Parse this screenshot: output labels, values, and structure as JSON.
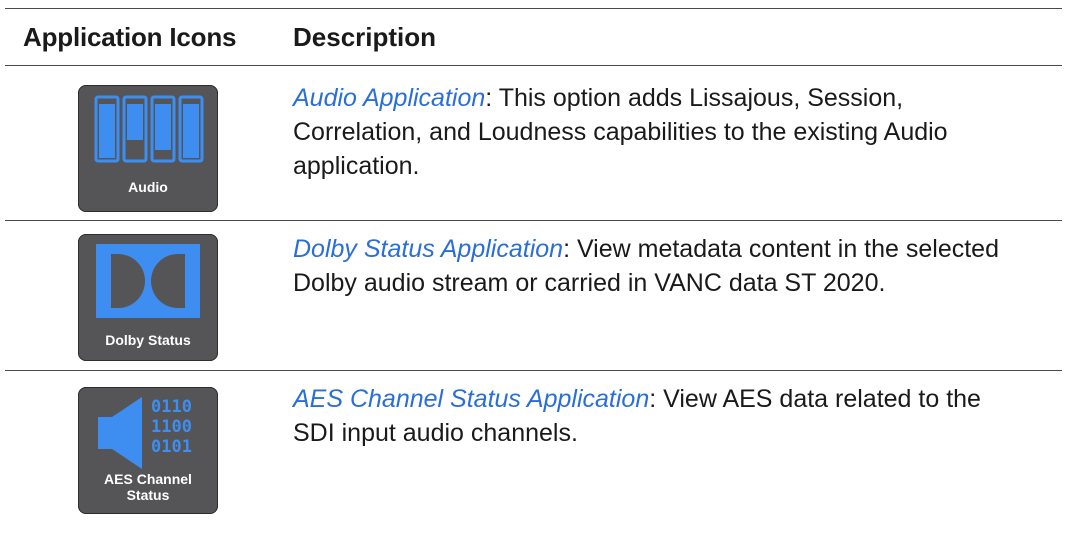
{
  "header": {
    "col1": "Application Icons",
    "col2": "Description"
  },
  "rows": [
    {
      "icon_name": "audio-app-icon",
      "icon_label": "Audio",
      "link": "Audio Application",
      "text": ": This option adds Lissajous, Session, Correlation, and Loudness capabilities to the existing Audio application."
    },
    {
      "icon_name": "dolby-status-app-icon",
      "icon_label": "Dolby Status",
      "link": "Dolby Status Application",
      "text": ": View metadata content in the selected Dolby audio stream or carried in VANC data ST 2020."
    },
    {
      "icon_name": "aes-channel-status-app-icon",
      "icon_label_line1": "AES Channel",
      "icon_label_line2": "Status",
      "icon_binary_1": "0110",
      "icon_binary_2": "1100",
      "icon_binary_3": "0101",
      "link": "AES Channel Status Application",
      "text": ": View AES data related to the SDI input audio channels."
    }
  ],
  "colors": {
    "accent": "#2a6fd8",
    "icon_blue": "#3d8ef0",
    "icon_bg": "#555558"
  }
}
